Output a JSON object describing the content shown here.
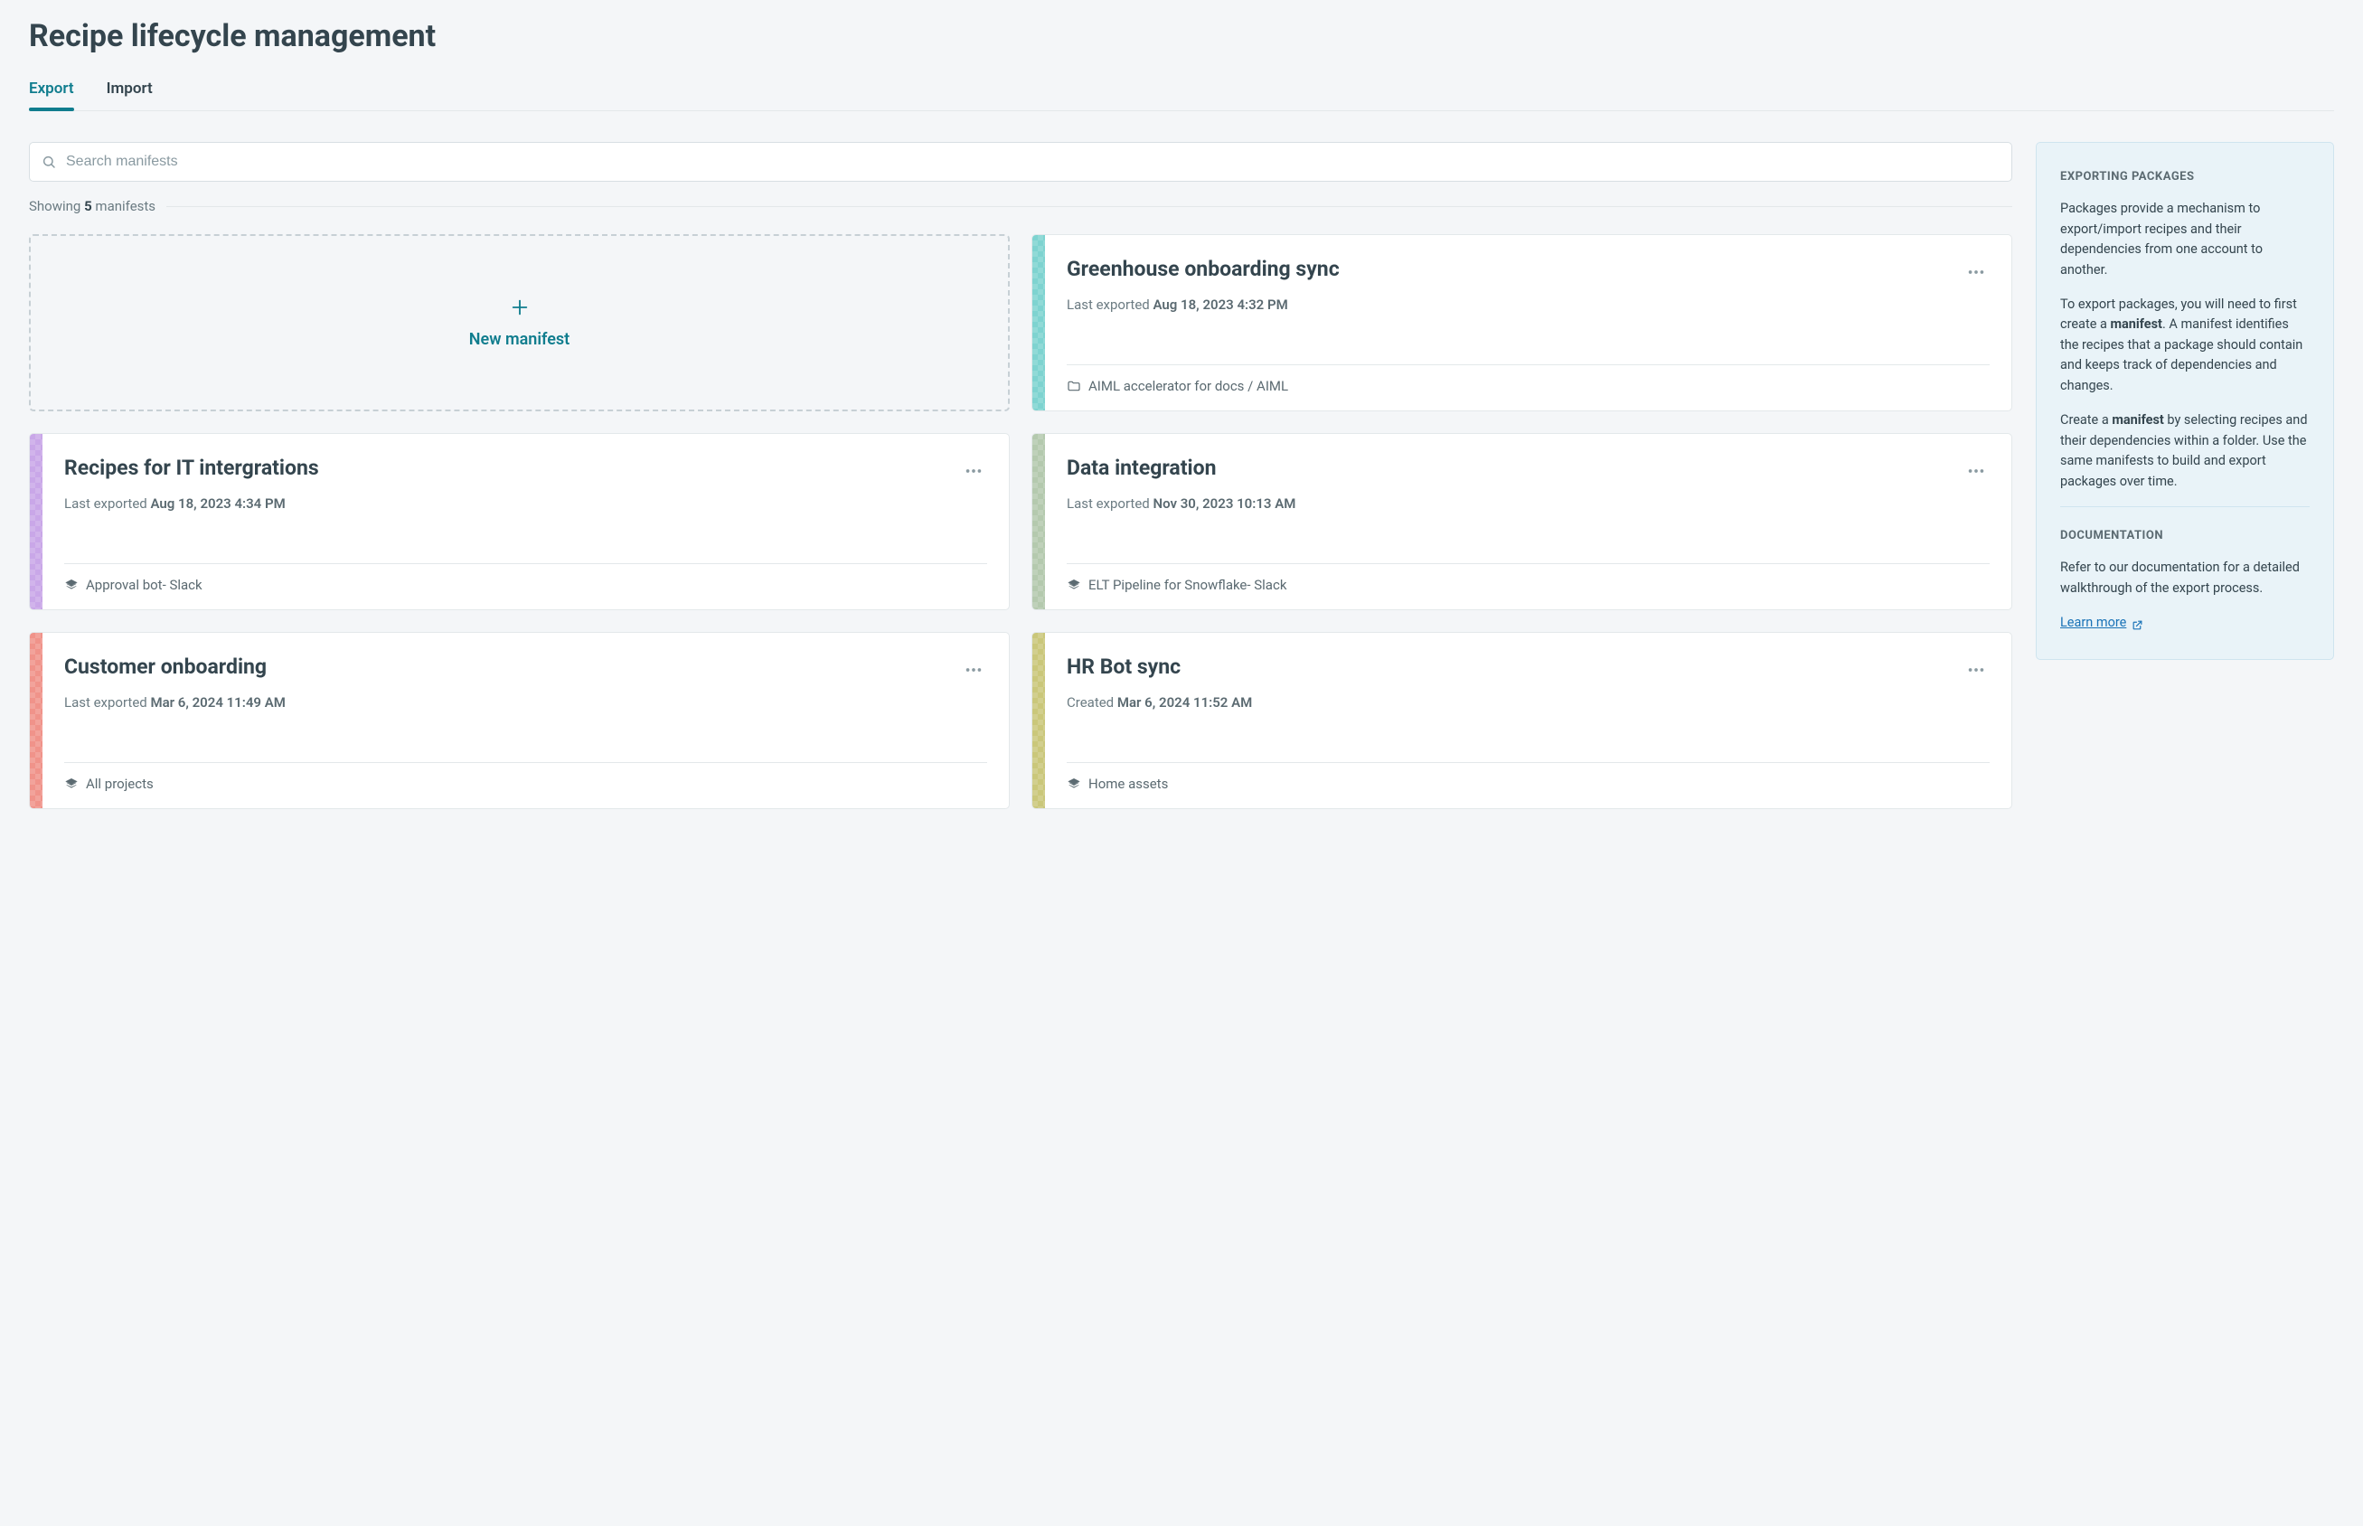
{
  "page": {
    "title": "Recipe lifecycle management"
  },
  "tabs": {
    "export": "Export",
    "import": "Import"
  },
  "search": {
    "placeholder": "Search manifests"
  },
  "showing": {
    "prefix": "Showing ",
    "count": "5",
    "suffix": " manifests"
  },
  "new_manifest": {
    "label": "New manifest"
  },
  "cards": [
    {
      "title": "Greenhouse onboarding sync",
      "sub_label": "Last exported ",
      "sub_value": "Aug 18, 2023 4:32 PM",
      "footer_icon": "folder",
      "footer_text": "AIML accelerator for docs / AIML",
      "stripe": "teal"
    },
    {
      "title": "Recipes for IT intergrations",
      "sub_label": "Last exported ",
      "sub_value": "Aug 18, 2023 4:34 PM",
      "footer_icon": "stack",
      "footer_text": "Approval bot- Slack",
      "stripe": "purple"
    },
    {
      "title": "Data integration",
      "sub_label": "Last exported ",
      "sub_value": "Nov 30, 2023 10:13 AM",
      "footer_icon": "stack",
      "footer_text": "ELT Pipeline for Snowflake- Slack",
      "stripe": "sage"
    },
    {
      "title": "Customer onboarding",
      "sub_label": "Last exported ",
      "sub_value": "Mar 6, 2024 11:49 AM",
      "footer_icon": "stack",
      "footer_text": "All projects",
      "stripe": "coral"
    },
    {
      "title": "HR Bot sync",
      "sub_label": "Created ",
      "sub_value": "Mar 6, 2024 11:52 AM",
      "footer_icon": "stack",
      "footer_text": "Home assets",
      "stripe": "olive"
    }
  ],
  "info": {
    "heading1": "EXPORTING PACKAGES",
    "p1": "Packages provide a mechanism to export/import recipes and their dependencies from one account to another.",
    "p2_a": "To export packages, you will need to first create a ",
    "p2_b": "manifest",
    "p2_c": ". A manifest identifies the recipes that a package should contain and keeps track of dependencies and changes.",
    "p3_a": "Create a ",
    "p3_b": "manifest",
    "p3_c": " by selecting recipes and their dependencies within a folder. Use the same manifests to build and export packages over time.",
    "heading2": "DOCUMENTATION",
    "p4": "Refer to our documentation for a detailed walkthrough of the export process.",
    "learn_more": "Learn more"
  }
}
